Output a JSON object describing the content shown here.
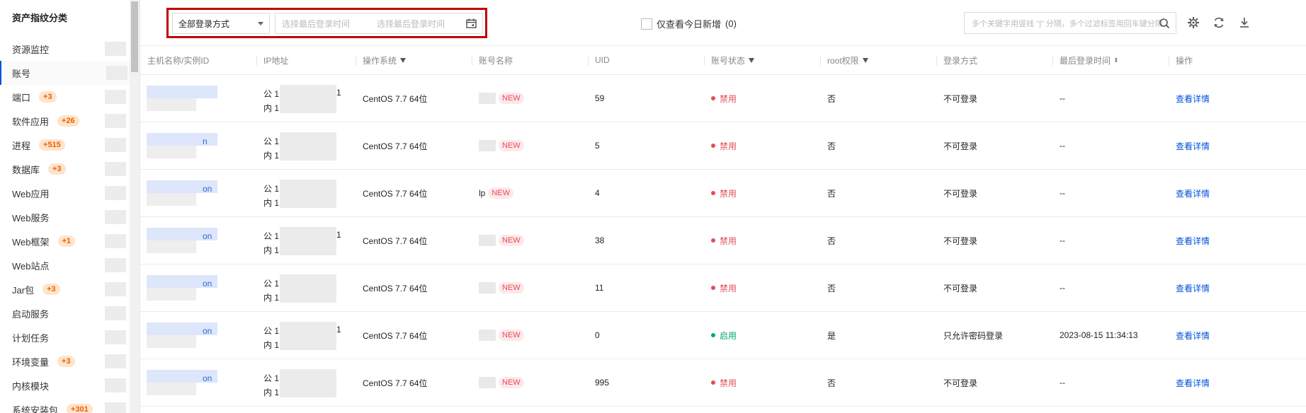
{
  "sidebar": {
    "title": "资产指纹分类",
    "items": [
      {
        "label": "资源监控",
        "badge": ""
      },
      {
        "label": "账号",
        "badge": ""
      },
      {
        "label": "端口",
        "badge": "+3"
      },
      {
        "label": "软件应用",
        "badge": "+26"
      },
      {
        "label": "进程",
        "badge": "+515"
      },
      {
        "label": "数据库",
        "badge": "+3"
      },
      {
        "label": "Web应用",
        "badge": ""
      },
      {
        "label": "Web服务",
        "badge": ""
      },
      {
        "label": "Web框架",
        "badge": "+1"
      },
      {
        "label": "Web站点",
        "badge": ""
      },
      {
        "label": "Jar包",
        "badge": "+3"
      },
      {
        "label": "启动服务",
        "badge": ""
      },
      {
        "label": "计划任务",
        "badge": ""
      },
      {
        "label": "环境变量",
        "badge": "+3"
      },
      {
        "label": "内核模块",
        "badge": ""
      },
      {
        "label": "系统安装包",
        "badge": "+301"
      }
    ]
  },
  "toolbar": {
    "login_method_select": "全部登录方式",
    "date_start_placeholder": "选择最后登录时间",
    "date_end_placeholder": "选择最后登录时间",
    "today_only_label": "仅查看今日新增",
    "today_only_count": "(0)",
    "search_placeholder": "多个关键字用竖线 \"|\" 分隔，多个过滤标签用回车键分隔"
  },
  "table": {
    "headers": {
      "host": "主机名称/实例ID",
      "ip": "IP地址",
      "os": "操作系统",
      "account": "账号名称",
      "uid": "UID",
      "status": "账号状态",
      "root": "root权限",
      "login": "登录方式",
      "last_login": "最后登录时间",
      "action": "操作"
    },
    "rows": [
      {
        "host_suffix": "",
        "ip_pub": "公 1",
        "ip_pub_tail": "1",
        "ip_in": "内 1",
        "os": "CentOS 7.7 64位",
        "acct_prefix": "",
        "new": "NEW",
        "uid": "59",
        "status": "禁用",
        "status_color": "#e34d59",
        "root": "否",
        "login": "不可登录",
        "last_login": "--",
        "action": "查看详情"
      },
      {
        "host_suffix": "n",
        "ip_pub": "公 1",
        "ip_pub_tail": "",
        "ip_in": "内 1",
        "os": "CentOS 7.7 64位",
        "acct_prefix": "",
        "new": "NEW",
        "uid": "5",
        "status": "禁用",
        "status_color": "#e34d59",
        "root": "否",
        "login": "不可登录",
        "last_login": "--",
        "action": "查看详情"
      },
      {
        "host_suffix": "on",
        "ip_pub": "公 1",
        "ip_pub_tail": "",
        "ip_in": "内 1",
        "os": "CentOS 7.7 64位",
        "acct_prefix": "lp",
        "new": "NEW",
        "uid": "4",
        "status": "禁用",
        "status_color": "#e34d59",
        "root": "否",
        "login": "不可登录",
        "last_login": "--",
        "action": "查看详情"
      },
      {
        "host_suffix": "on",
        "ip_pub": "公 1",
        "ip_pub_tail": "1",
        "ip_in": "内 1",
        "os": "CentOS 7.7 64位",
        "acct_prefix": "",
        "new": "NEW",
        "uid": "38",
        "status": "禁用",
        "status_color": "#e34d59",
        "root": "否",
        "login": "不可登录",
        "last_login": "--",
        "action": "查看详情"
      },
      {
        "host_suffix": "on",
        "ip_pub": "公 1",
        "ip_pub_tail": "",
        "ip_in": "内 1",
        "os": "CentOS 7.7 64位",
        "acct_prefix": "",
        "new": "NEW",
        "uid": "11",
        "status": "禁用",
        "status_color": "#e34d59",
        "root": "否",
        "login": "不可登录",
        "last_login": "--",
        "action": "查看详情"
      },
      {
        "host_suffix": "on",
        "ip_pub": "公 1",
        "ip_pub_tail": "1",
        "ip_in": "内 1",
        "os": "CentOS 7.7 64位",
        "acct_prefix": "",
        "new": "NEW",
        "uid": "0",
        "status": "启用",
        "status_color": "#00a870",
        "root": "是",
        "login": "只允许密码登录",
        "last_login": "2023-08-15 11:34:13",
        "action": "查看详情"
      },
      {
        "host_suffix": "on",
        "ip_pub": "公 1",
        "ip_pub_tail": "",
        "ip_in": "内 1",
        "os": "CentOS 7.7 64位",
        "acct_prefix": "",
        "new": "NEW",
        "uid": "995",
        "status": "禁用",
        "status_color": "#e34d59",
        "root": "否",
        "login": "不可登录",
        "last_login": "--",
        "action": "查看详情"
      }
    ]
  },
  "colors": {
    "accent": "#0052d9",
    "highlight_border": "#c00000",
    "disabled": "#e34d59",
    "enabled": "#00a870",
    "badge": "#f06000"
  },
  "icons": [
    "calendar-icon",
    "search-icon",
    "settings-icon",
    "refresh-icon",
    "download-icon",
    "filter-icon",
    "sort-icon",
    "chevron-down-icon"
  ]
}
